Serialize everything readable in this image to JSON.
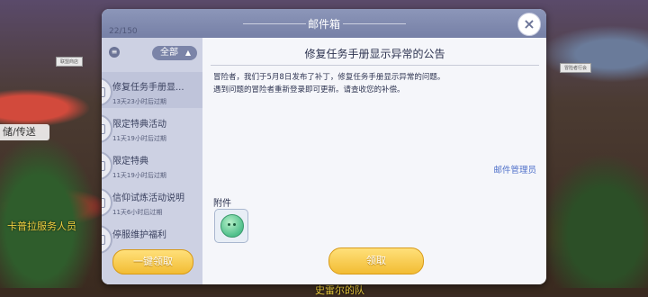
{
  "background": {
    "left_button": "储/传送",
    "staff_text": "卡普拉服务人员",
    "bottom_text": "史雷尔的队",
    "tag_left": "联盟商店",
    "tag_right": "冒险者行会"
  },
  "dialog": {
    "title": "邮件箱",
    "close_icon": "×",
    "mail_count": "22/150"
  },
  "sidebar": {
    "filter_label": "全部",
    "filter_caret": "▲",
    "list_icon": "≡",
    "mails": [
      {
        "subject": "修复任务手册显...",
        "expire": "13天23小时后过期",
        "active": true
      },
      {
        "subject": "限定特典活动",
        "expire": "11天19小时后过期",
        "active": false
      },
      {
        "subject": "限定特典",
        "expire": "11天19小时后过期",
        "active": false
      },
      {
        "subject": "信仰试炼活动说明",
        "expire": "11天6小时后过期",
        "active": false
      },
      {
        "subject": "停服维护福利",
        "expire": "",
        "active": false
      }
    ],
    "claim_all_label": "一键领取"
  },
  "content": {
    "title": "修复任务手册显示异常的公告",
    "body_line1": "冒险者，我们于5月8日发布了补丁，修复任务手册显示异常的问题。",
    "body_line2": "遇到问题的冒险者重新登录即可更新。请查收您的补偿。",
    "sender": "邮件管理员",
    "attachment_label": "附件",
    "claim_label": "领取"
  }
}
